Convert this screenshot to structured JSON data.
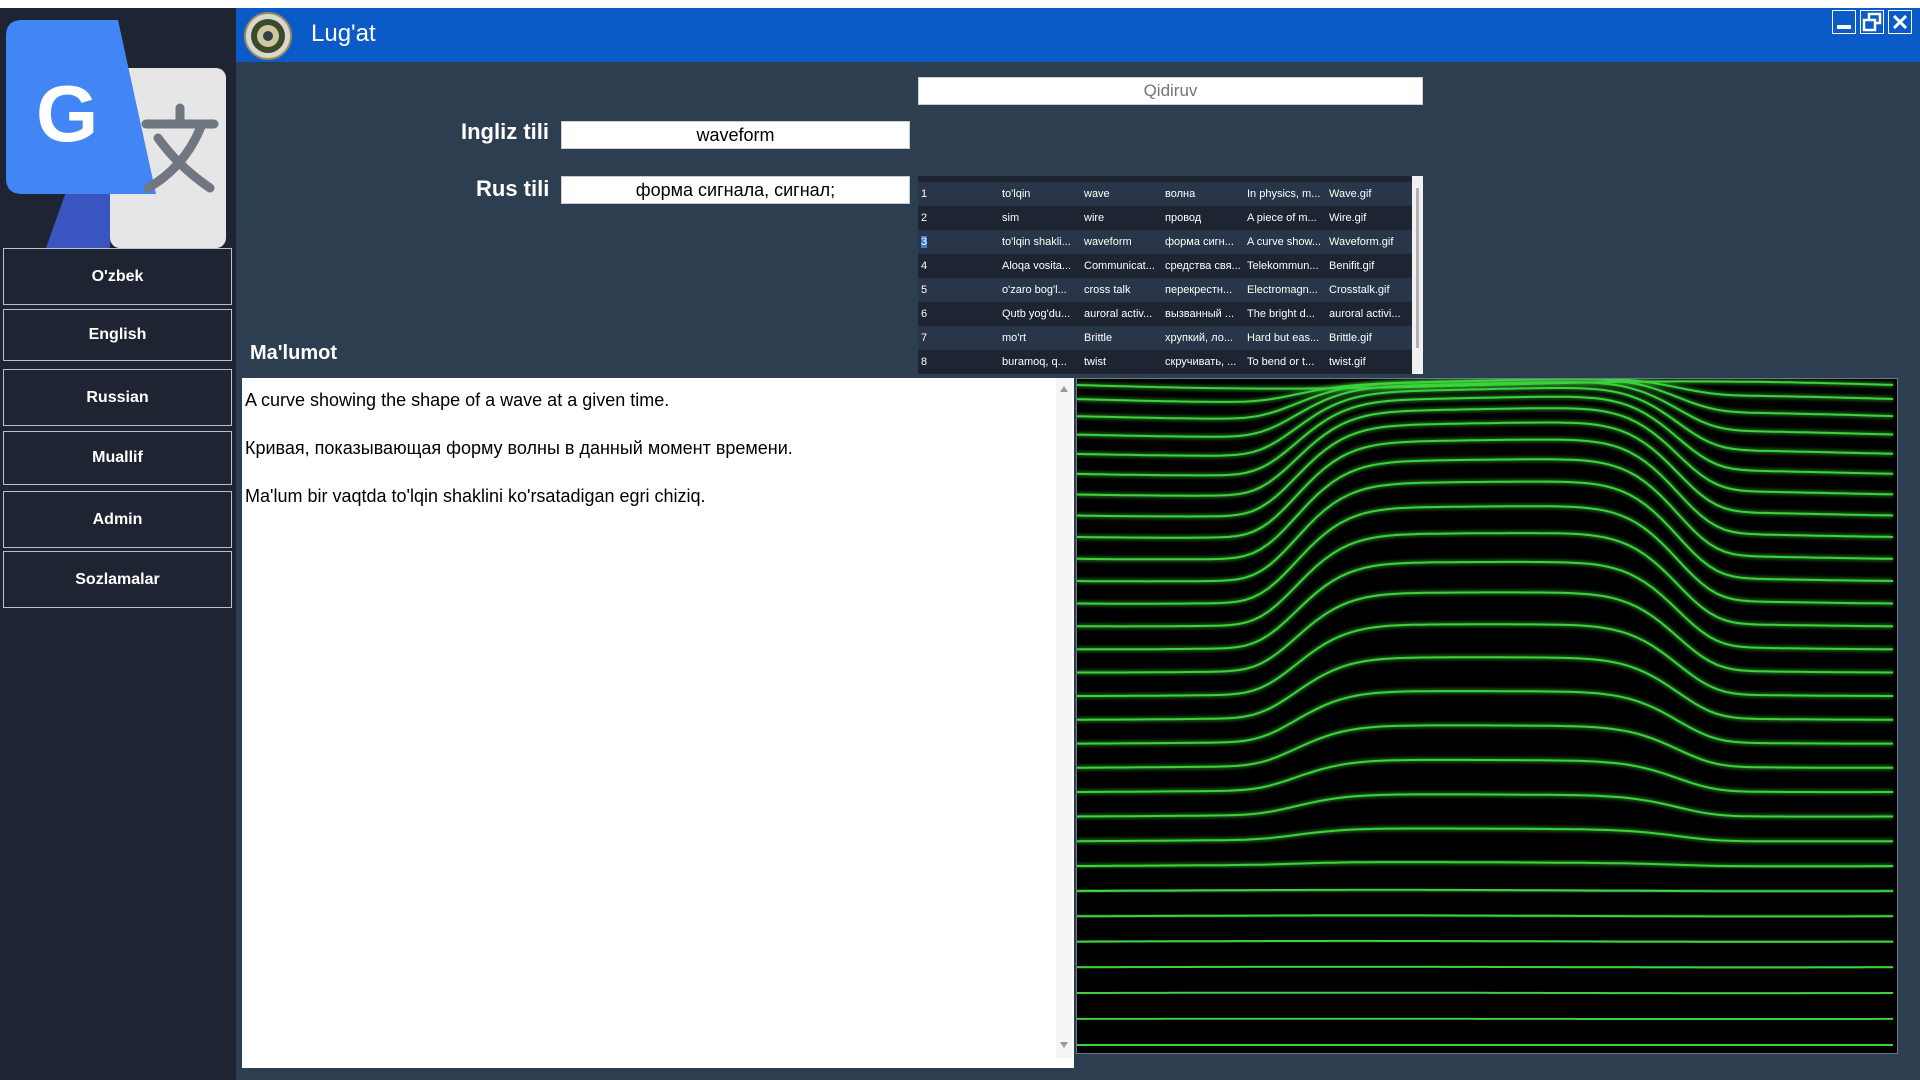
{
  "window": {
    "title": "Lug'at"
  },
  "sidebar": {
    "items": [
      {
        "label": "O'zbek"
      },
      {
        "label": "English"
      },
      {
        "label": "Russian"
      },
      {
        "label": "Muallif"
      },
      {
        "label": "Admin"
      },
      {
        "label": "Sozlamalar"
      }
    ]
  },
  "search": {
    "placeholder": "Qidiruv"
  },
  "form": {
    "english_label": "Ingliz tili",
    "english_value": "waveform",
    "russian_label": "Rus tili",
    "russian_value": "форма сигнала, сигнал;",
    "info_label": "Ma'lumot"
  },
  "table": {
    "selected_row": 2,
    "rows": [
      [
        "1",
        "to'lqin",
        "wave",
        "волна",
        "In physics, m...",
        "Wave.gif"
      ],
      [
        "2",
        "sim",
        "wire",
        "провод",
        "A piece of m...",
        "Wire.gif"
      ],
      [
        "3",
        "to'lqin shakli...",
        "waveform",
        "форма сигн...",
        "A curve show...",
        "Waveform.gif"
      ],
      [
        "4",
        "Aloqa vosita...",
        "Communicat...",
        "средства свя...",
        "Telekommun...",
        "Benifit.gif"
      ],
      [
        "5",
        "o'zaro bog'l...",
        "cross talk",
        "перекрестн...",
        "Electromagn...",
        "Crosstalk.gif"
      ],
      [
        "6",
        "Qutb yog'du...",
        "auroral activ...",
        "вызванный ...",
        "The bright d...",
        "auroral activi..."
      ],
      [
        "7",
        "mo'rt",
        "Brittle",
        "хрупкий, ло...",
        "Hard but eas...",
        "Brittle.gif"
      ],
      [
        "8",
        "buramoq, q...",
        "twist",
        "скручивать, ...",
        "To bend or t...",
        "twist.gif"
      ]
    ]
  },
  "info": {
    "lines": [
      "A curve showing the shape of a wave at a given time.",
      "Кривая, показывающая форму волны в данный момент времени.",
      "Ma'lum bir vaqtda to'lqin shaklini ko'rsatadigan egri chiziq."
    ]
  },
  "image": {
    "description_icon": "waveform-animation",
    "line_color": "#3cd23c"
  },
  "colors": {
    "sidebar_bg": "#1e2432",
    "main_bg": "#2c3e50",
    "titlebar_bg": "#0a5ac8",
    "google_blue": "#4285f4"
  }
}
